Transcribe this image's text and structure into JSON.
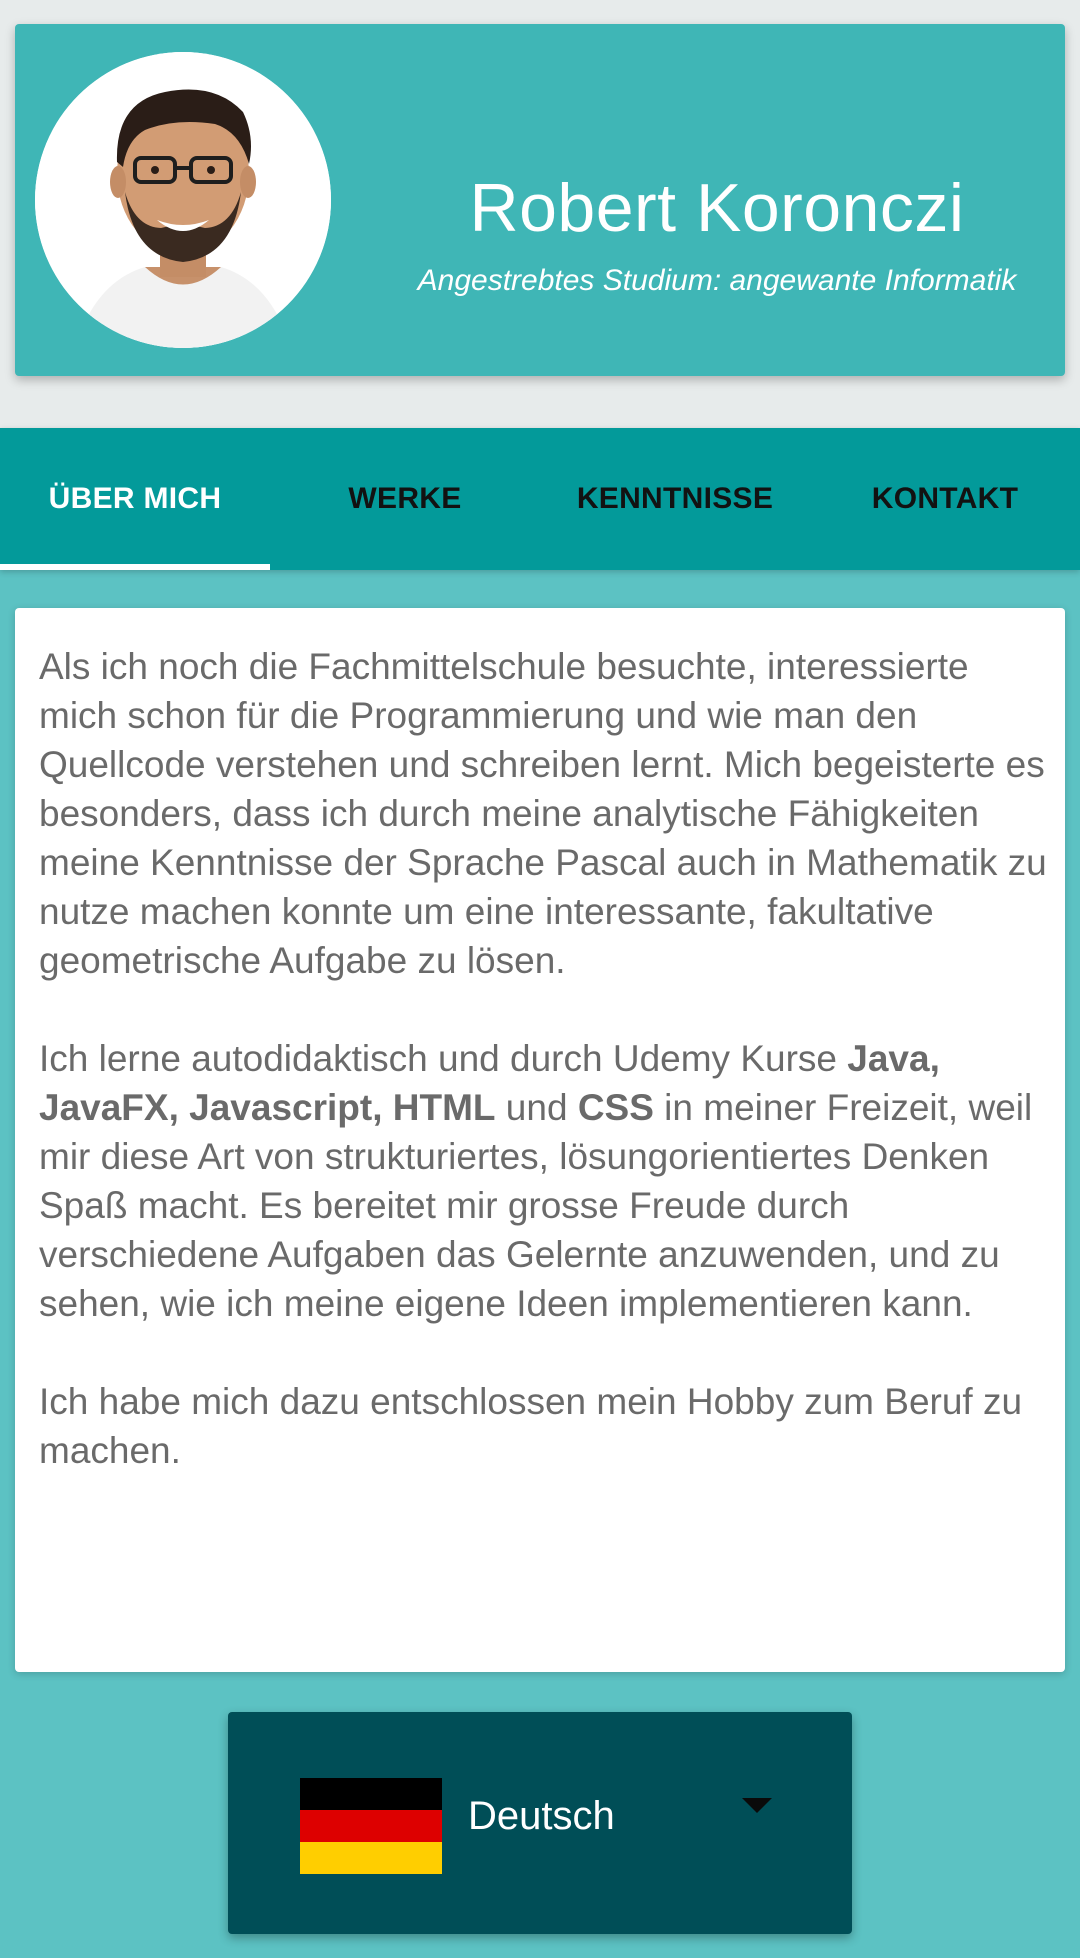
{
  "profile": {
    "name": "Robert Koronczi",
    "subtitle": "Angestrebtes Studium: angewante Informatik",
    "avatar_icon": "person-photo"
  },
  "tabs": [
    {
      "label": "ÜBER MICH",
      "active": true
    },
    {
      "label": "WERKE",
      "active": false
    },
    {
      "label": "KENNTNISSE",
      "active": false
    },
    {
      "label": "KONTAKT",
      "active": false
    }
  ],
  "about": {
    "p1": "Als ich noch die Fachmittelschule besuchte, interessierte mich schon für die Programmierung und wie man den Quellcode verstehen und schreiben lernt. Mich begeisterte es besonders, dass ich durch meine analytische Fähigkeiten meine Kenntnisse der Sprache Pascal auch in Mathematik zu nutze machen konnte um eine interessante, fakultative geometrische Aufgabe zu lösen.",
    "p2_intro": "Ich lerne autodidaktisch und durch Udemy Kurse ",
    "p2_bold1": "Java, JavaFX, Javascript, HTML",
    "p2_and": " und ",
    "p2_bold2": "CSS",
    "p2_rest": " in meiner Freizeit, weil mir diese Art von strukturiertes, lösungorientiertes Denken Spaß macht. Es bereitet mir grosse Freude durch verschiedene Aufgaben das Gelernte anzuwenden, und zu sehen, wie ich meine eigene Ideen implementieren kann.",
    "p3": "Ich habe mich dazu entschlossen mein Hobby zum Beruf zu machen."
  },
  "language_select": {
    "selected": "Deutsch",
    "flag_icon": "germany-flag-icon"
  },
  "colors": {
    "page_bg": "#5cc2c3",
    "header_card": "#3fb6b6",
    "tabbar": "#039a9a",
    "language_select_bg": "#004e57",
    "text_gray": "#6a6a6a"
  }
}
